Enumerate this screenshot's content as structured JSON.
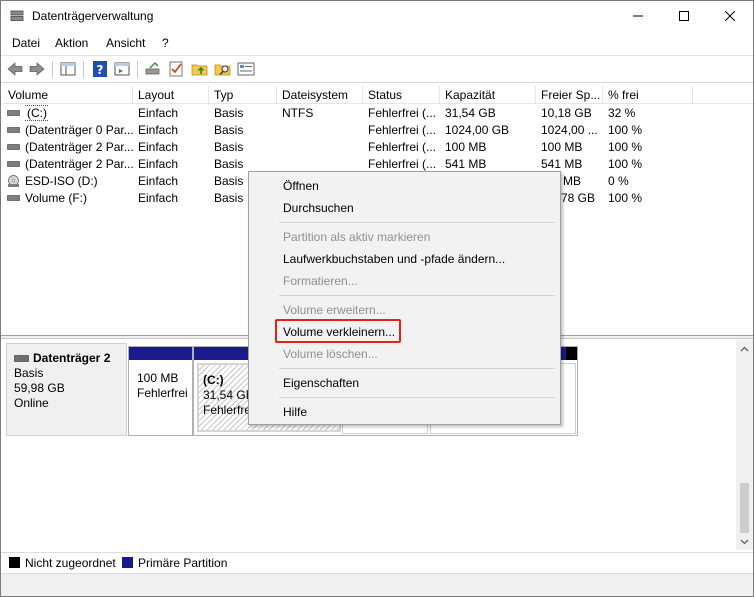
{
  "window": {
    "title": "Datenträgerverwaltung"
  },
  "menu": [
    "Datei",
    "Aktion",
    "Ansicht",
    "?"
  ],
  "table": {
    "columns": [
      "Volume",
      "Layout",
      "Typ",
      "Dateisystem",
      "Status",
      "Kapazität",
      "Freier Sp...",
      "% frei"
    ],
    "rows": [
      [
        "(C:)",
        "Einfach",
        "Basis",
        "NTFS",
        "Fehlerfrei (...",
        "31,54 GB",
        "10,18 GB",
        "32 %"
      ],
      [
        "(Datenträger 0 Par...",
        "Einfach",
        "Basis",
        "",
        "Fehlerfrei (...",
        "1024,00 GB",
        "1024,00 ...",
        "100 %"
      ],
      [
        "(Datenträger 2 Par...",
        "Einfach",
        "Basis",
        "",
        "Fehlerfrei (...",
        "100 MB",
        "100 MB",
        "100 %"
      ],
      [
        "(Datenträger 2 Par...",
        "Einfach",
        "Basis",
        "",
        "Fehlerfrei (...",
        "541 MB",
        "541 MB",
        "100 %"
      ],
      [
        "ESD-ISO (D:)",
        "Einfach",
        "Basis",
        "",
        "",
        "",
        "MB",
        "0 %"
      ],
      [
        "Volume (F:)",
        "Einfach",
        "Basis",
        "",
        "",
        "",
        "78 GB",
        "100 %"
      ]
    ]
  },
  "disk": {
    "name": "Datenträger 2",
    "type": "Basis",
    "size": "59,98 GB",
    "state": "Online",
    "partitions": [
      {
        "size": "100 MB",
        "status": "Fehlerfrei"
      },
      {
        "label": "(C:)",
        "size": "31,54 GB",
        "status": "Fehlerfre"
      }
    ]
  },
  "legend": [
    {
      "label": "Nicht zugeordnet",
      "color": "#000000"
    },
    {
      "label": "Primäre Partition",
      "color": "#1a1a8c"
    }
  ],
  "context_menu": {
    "items": [
      {
        "label": "Öffnen",
        "disabled": false
      },
      {
        "label": "Durchsuchen",
        "disabled": false
      },
      {
        "label": "Partition als aktiv markieren",
        "disabled": true
      },
      {
        "label": "Laufwerkbuchstaben und -pfade ändern...",
        "disabled": false
      },
      {
        "label": "Formatieren...",
        "disabled": true
      },
      {
        "label": "Volume erweitern...",
        "disabled": true
      },
      {
        "label": "Volume verkleinern...",
        "disabled": false,
        "highlighted": true
      },
      {
        "label": "Volume löschen...",
        "disabled": true
      },
      {
        "label": "Eigenschaften",
        "disabled": false
      },
      {
        "label": "Hilfe",
        "disabled": false
      }
    ],
    "highlight_color": "#e0241b"
  }
}
